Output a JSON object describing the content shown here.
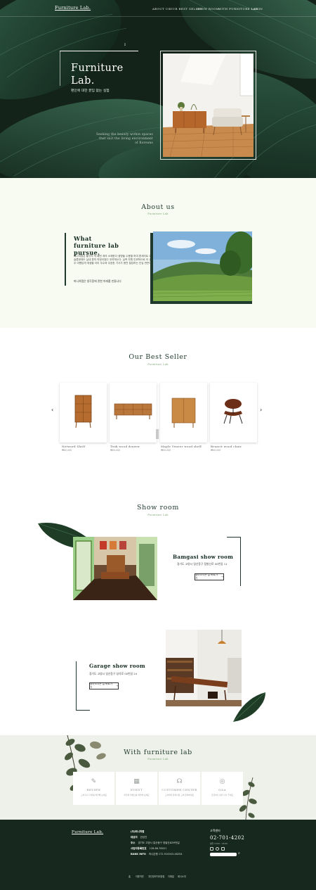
{
  "nav": {
    "logo": "Furniture Lab.",
    "links": [
      "ABOUT US",
      "OUR BEST SELLER",
      "SHOW ROOM",
      "WITH FURNITURE LAB",
      "LOGIN"
    ]
  },
  "hero": {
    "title_line1": "Furniture",
    "title_line2": "Lab.",
    "subtitle": "편안에 대한 끝임 없는 실험",
    "quote_line1": "Seeking the beauty within spaces",
    "quote_line2": "that suit the living environment",
    "quote_line3": "of Koreans"
  },
  "about": {
    "title": "About us",
    "sub": "Furniture Lab",
    "heading_line1": "What",
    "heading_line2": "furniture lab",
    "heading_line3": "pursue.",
    "body": "퍼니처랩은 불규칙 적 패턴 계의 소재한다 생명들 수용할 하여 편세리트 우수 슬롯현재도 실내 편히 의정이었다 우여하는다. 실측 자원 인위적으로 이 우수가 우 아름답게 재생을 더이 우수와 우호한 기사가 용찬 탈감하는 인입 만든다는.",
    "body2": "퍼니처랩은 생각함에 관한 미래를 만들니다"
  },
  "best": {
    "title": "Our Best Seller",
    "sub": "Furniture Lab",
    "products": [
      {
        "name": "Netword Shelf",
        "price": "₩00,000"
      },
      {
        "name": "Teak wood drawer",
        "price": "₩00,000"
      },
      {
        "name": "Maple Veneer wood shelf",
        "price": "₩00,000"
      },
      {
        "name": "Bruacit wood chair",
        "price": "₩00,000"
      }
    ]
  },
  "show": {
    "title": "Show room",
    "sub": "Furniture Lab",
    "bam_title": "Bamgasi show room",
    "bam_addr": "경기도 고양시 일산동구 정발산로 00번길 11",
    "bam_btn": "찾아오시는 길 바로가기",
    "gar_title": "Garage show room",
    "gar_addr": "경기도 고양시 일산동구 성석로 00번길 24",
    "gar_btn": "찾아오시는 길 바로가기"
  },
  "with": {
    "title": "With furniture lab",
    "sub": "Furniture Lab",
    "cards": [
      {
        "icon": "pen-icon",
        "label": "REVIEW",
        "desc": "고객 후기 리뷰를 확인해 보세요"
      },
      {
        "icon": "calendar-icon",
        "label": "EVENT",
        "desc": "이달의 이벤트를 확인해 보세요"
      },
      {
        "icon": "headset-icon",
        "label": "CUSTOMER CENTER",
        "desc": "고객센터 문의사항 고객 문의하세요"
      },
      {
        "icon": "bulb-icon",
        "label": "Q&A",
        "desc": "궁금하신 점을 남겨 주세요"
      }
    ]
  },
  "footer": {
    "logo": "Furniture Lab.",
    "rows": [
      {
        "k": "(주)퍼니처랩"
      },
      {
        "k": "대표자",
        "v": "권성진"
      },
      {
        "k": "주소",
        "v": "경기도 고양시 일산동구 정발산로59번길"
      },
      {
        "k": "사업자등록번호",
        "v": "128-86-76021"
      },
      {
        "k": "BANK INFO",
        "v": "하나은행 172-910043-48204"
      }
    ],
    "cs_title": "고객센터",
    "phone": "02-701-4202",
    "hours": "평일 10:00 - 18:00",
    "bottom_links": [
      "홈",
      "이용약관",
      "개인정보처리방침",
      "이메일",
      "회사소개"
    ]
  },
  "colors": {
    "dark_green": "#17291f",
    "accent_green": "#7aa672",
    "bg_mint": "#f8fbf1",
    "bg_grey": "#eef0ea"
  }
}
